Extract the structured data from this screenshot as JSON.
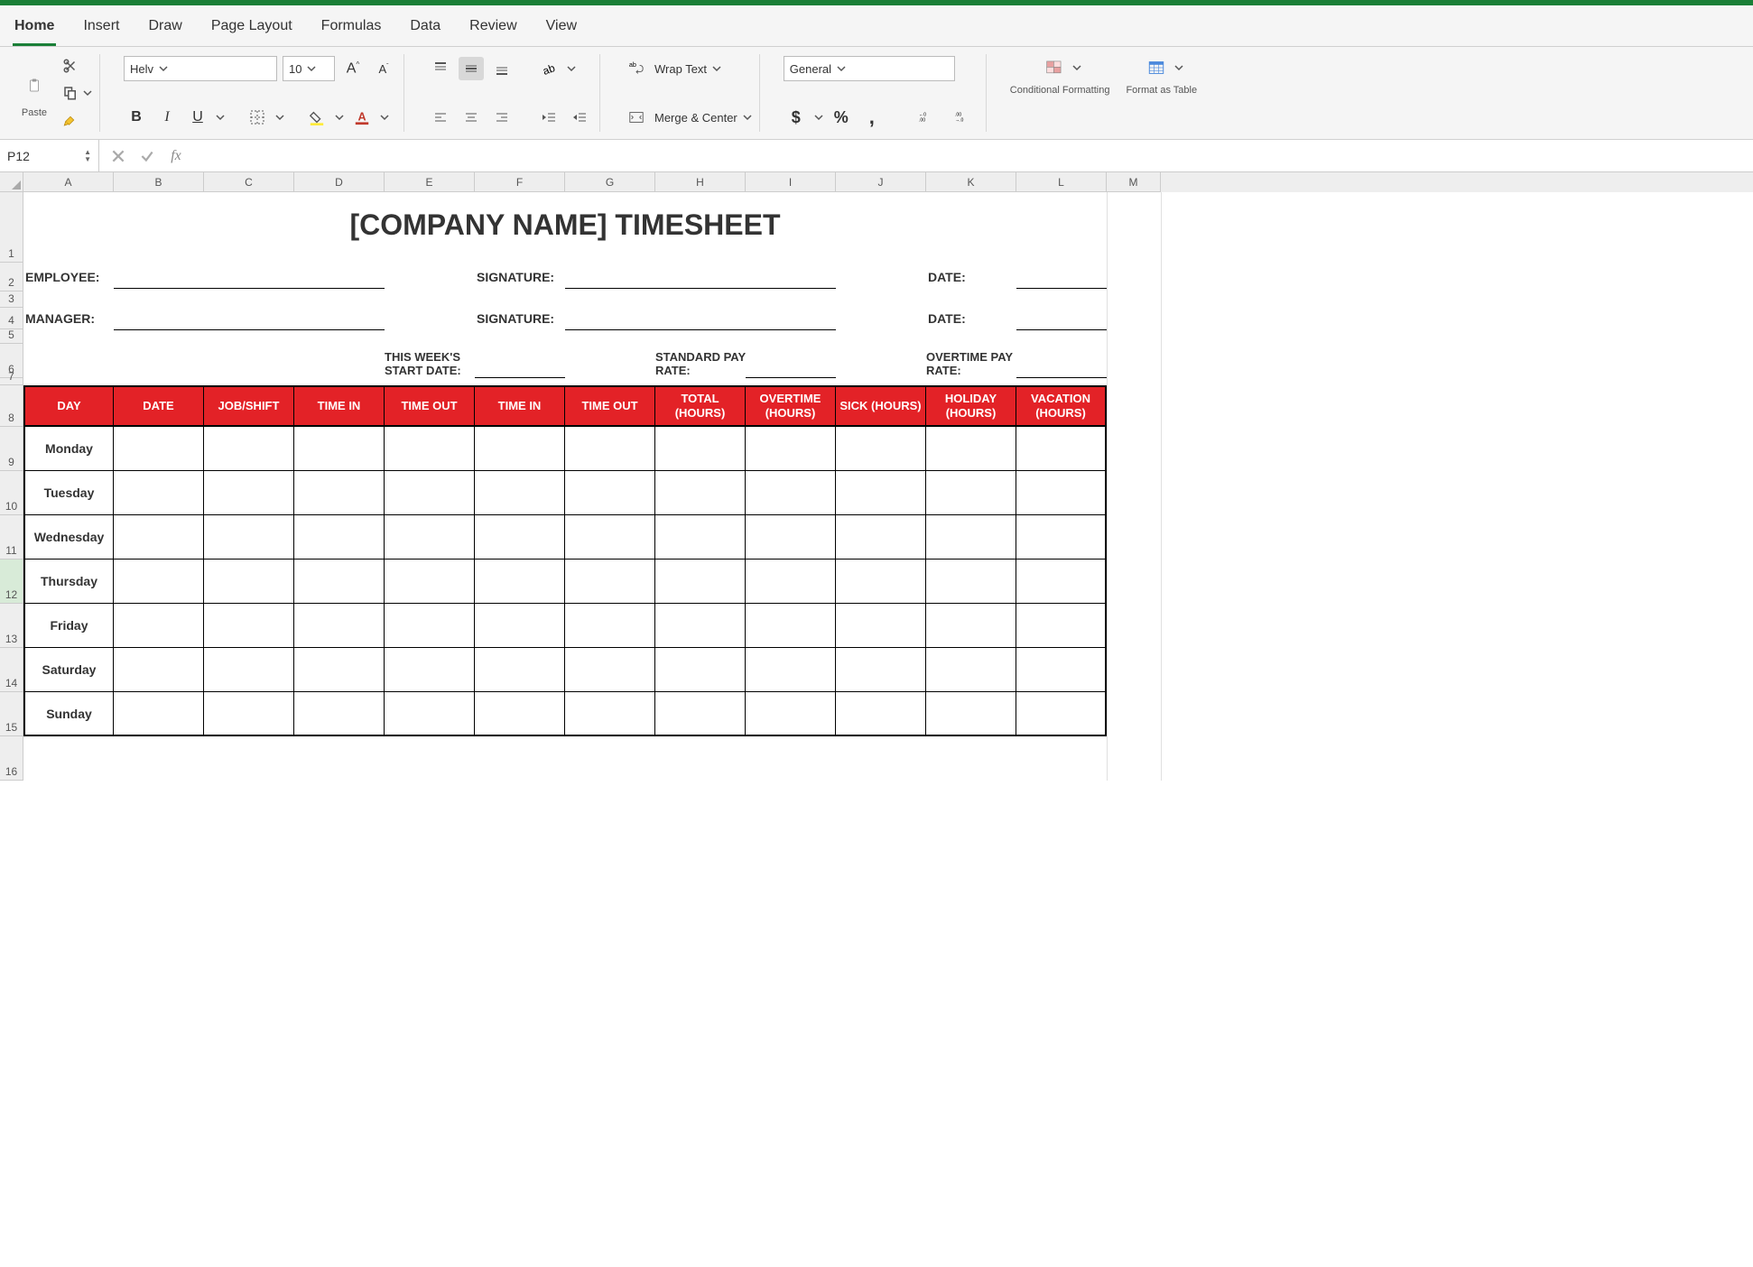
{
  "ribbon": {
    "tabs": [
      "Home",
      "Insert",
      "Draw",
      "Page Layout",
      "Formulas",
      "Data",
      "Review",
      "View"
    ],
    "active_tab": "Home",
    "paste_label": "Paste",
    "font_name": "Helv",
    "font_size": "10",
    "wrap_text": "Wrap Text",
    "merge_center": "Merge & Center",
    "number_format": "General",
    "cond_format": "Conditional Formatting",
    "format_table": "Format as Table"
  },
  "formula_bar": {
    "name_box": "P12",
    "fx": "fx",
    "formula": ""
  },
  "columns": [
    "A",
    "B",
    "C",
    "D",
    "E",
    "F",
    "G",
    "H",
    "I",
    "J",
    "K",
    "L",
    "M"
  ],
  "rows": [
    "1",
    "2",
    "3",
    "4",
    "5",
    "6",
    "7",
    "8",
    "9",
    "10",
    "11",
    "12",
    "13",
    "14",
    "15",
    "16"
  ],
  "sheet": {
    "title": "[COMPANY NAME] TIMESHEET",
    "employee_label": "EMPLOYEE:",
    "manager_label": "MANAGER:",
    "signature_label": "SIGNATURE:",
    "date_label": "DATE:",
    "week_start_label": "THIS WEEK'S START DATE:",
    "std_pay_label": "STANDARD PAY RATE:",
    "ot_pay_label": "OVERTIME PAY RATE:",
    "headers": [
      "DAY",
      "DATE",
      "JOB/SHIFT",
      "TIME IN",
      "TIME OUT",
      "TIME IN",
      "TIME OUT",
      "TOTAL (HOURS)",
      "OVERTIME (HOURS)",
      "SICK (HOURS)",
      "HOLIDAY (HOURS)",
      "VACATION (HOURS)"
    ],
    "days": [
      "Monday",
      "Tuesday",
      "Wednesday",
      "Thursday",
      "Friday",
      "Saturday",
      "Sunday"
    ]
  }
}
